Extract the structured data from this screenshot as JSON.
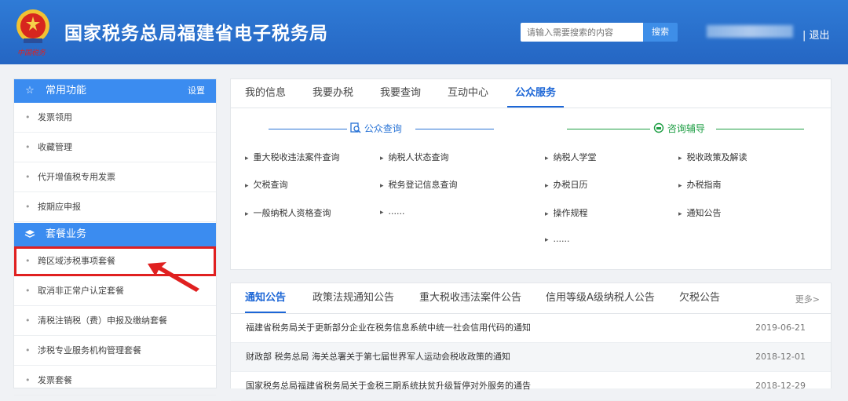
{
  "header": {
    "title": "国家税务总局福建省电子税务局",
    "slogan": "中国税务",
    "search_placeholder": "请输入需要搜索的内容",
    "search_button": "搜索",
    "logout": "| 退出"
  },
  "sidebar": {
    "group1": {
      "title": "常用功能",
      "settings": "设置",
      "icon": "star-icon"
    },
    "group1_items": [
      "发票领用",
      "收藏管理",
      "代开增值税专用发票",
      "按期应申报"
    ],
    "group2": {
      "title": "套餐业务",
      "icon": "layers-icon"
    },
    "group2_items": [
      "跨区域涉税事项套餐",
      "取消非正常户认定套餐",
      "清税注销税（费）申报及缴纳套餐",
      "涉税专业服务机构管理套餐",
      "发票套餐"
    ]
  },
  "main_tabs": [
    "我的信息",
    "我要办税",
    "我要查询",
    "互动中心",
    "公众服务"
  ],
  "public_query": {
    "title": "公众查询",
    "icon": "search-doc-icon",
    "col1": [
      "重大税收违法案件查询",
      "欠税查询",
      "一般纳税人资格查询"
    ],
    "col2": [
      "纳税人状态查询",
      "税务登记信息查询",
      "......"
    ]
  },
  "consult": {
    "title": "咨询辅导",
    "icon": "consult-icon",
    "col1": [
      "纳税人学堂",
      "办税日历",
      "操作规程",
      "......"
    ],
    "col2": [
      "税收政策及解读",
      "办税指南",
      "通知公告"
    ]
  },
  "notice_tabs": [
    "通知公告",
    "政策法规通知公告",
    "重大税收违法案件公告",
    "信用等级A级纳税人公告",
    "欠税公告"
  ],
  "more": "更多>",
  "notices": [
    {
      "title": "福建省税务局关于更新部分企业在税务信息系统中统一社会信用代码的通知",
      "date": "2019-06-21"
    },
    {
      "title": "财政部 税务总局 海关总署关于第七届世界军人运动会税收政策的通知",
      "date": "2018-12-01"
    },
    {
      "title": "国家税务总局福建省税务局关于金税三期系统扶贫升级暂停对外服务的通告",
      "date": "2018-12-29"
    }
  ],
  "colors": {
    "header": "#2566c3",
    "accent": "#3b8cf0",
    "active_tab": "#1c66d6",
    "highlight": "#e02020",
    "consult_green": "#1e9e44"
  }
}
